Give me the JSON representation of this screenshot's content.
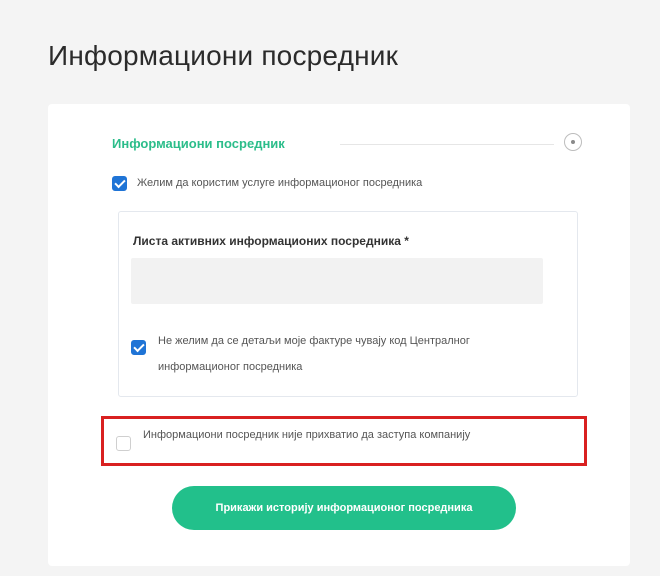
{
  "page": {
    "title": "Информациони посредник"
  },
  "section": {
    "title": "Информациони посредник"
  },
  "use_intermediary": {
    "checked": true,
    "label": "Желим да користим услуге информационог посредника"
  },
  "intermediary_list": {
    "label": "Листа активних информационих посредника *",
    "value": ""
  },
  "central_storage_opt_out": {
    "checked": true,
    "label": "Не желим да се детаљи моје фактуре чувају код Централног информационог посредника"
  },
  "not_accepted_notice": {
    "checked": false,
    "label": "Информациони посредник није прихватио да заступа компанију"
  },
  "history_button": {
    "label": "Прикажи историју информационог посредника"
  },
  "colors": {
    "accent": "#22c08b",
    "checkbox": "#1f74d6",
    "highlight": "#d92020"
  }
}
